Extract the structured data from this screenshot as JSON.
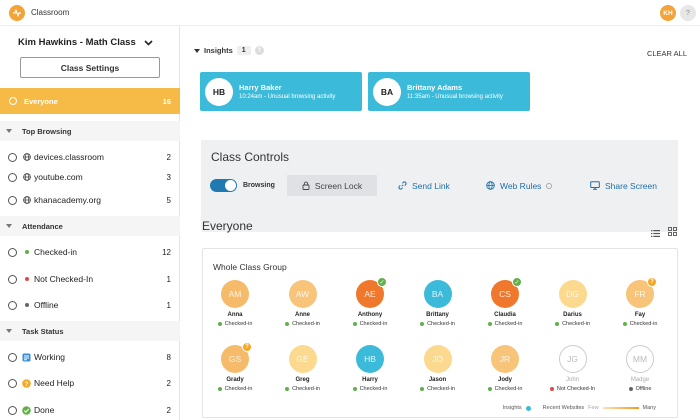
{
  "app": {
    "title": "Classroom",
    "user_initials": "KH",
    "help_label": "?"
  },
  "sidebar": {
    "class_name": "Kim Hawkins - Math Class",
    "settings_label": "Class Settings",
    "everyone": {
      "label": "Everyone",
      "count": "16"
    },
    "sections": {
      "top_browsing": "Top Browsing",
      "attendance": "Attendance",
      "task_status": "Task Status"
    },
    "top_browsing": [
      {
        "label": "devices.classroom",
        "count": "2"
      },
      {
        "label": "youtube.com",
        "count": "3"
      },
      {
        "label": "khanacademy.org",
        "count": "5"
      }
    ],
    "attendance": [
      {
        "label": "Checked-in",
        "count": "12"
      },
      {
        "label": "Not Checked-In",
        "count": "1"
      },
      {
        "label": "Offline",
        "count": "1"
      }
    ],
    "task_status": [
      {
        "label": "Working",
        "count": "8"
      },
      {
        "label": "Need Help",
        "count": "2"
      },
      {
        "label": "Done",
        "count": "2"
      }
    ]
  },
  "insights": {
    "label": "Insights",
    "count": "1",
    "help": "?",
    "clear_all": "CLEAR ALL",
    "cards": [
      {
        "initials": "HB",
        "name": "Harry Baker",
        "detail": "10:24am - Unusual browsing activity"
      },
      {
        "initials": "BA",
        "name": "Brittany Adams",
        "detail": "11:35am - Unusual browsing activity"
      }
    ]
  },
  "controls": {
    "title": "Class Controls",
    "browsing_label": "Browsing",
    "browsing_on": true,
    "screen_lock": "Screen Lock",
    "send_link": "Send Link",
    "web_rules": "Web Rules",
    "share_screen": "Share Screen"
  },
  "main": {
    "title": "Everyone",
    "group_title": "Whole Class Group"
  },
  "students": [
    {
      "initials": "AM",
      "name": "Anna",
      "status": "Checked-in",
      "color": "#f6bb6a",
      "badge": ""
    },
    {
      "initials": "AW",
      "name": "Anne",
      "status": "Checked-in",
      "color": "#f7c47a",
      "badge": ""
    },
    {
      "initials": "AE",
      "name": "Anthony",
      "status": "Checked-in",
      "color": "#f0782d",
      "badge": "check"
    },
    {
      "initials": "BA",
      "name": "Brittany",
      "status": "Checked-in",
      "color": "#3cbad9",
      "badge": ""
    },
    {
      "initials": "CS",
      "name": "Claudia",
      "status": "Checked-in",
      "color": "#f0782d",
      "badge": "check"
    },
    {
      "initials": "DG",
      "name": "Darius",
      "status": "Checked-in",
      "color": "#fbd98e",
      "badge": ""
    },
    {
      "initials": "FR",
      "name": "Fay",
      "status": "Checked-in",
      "color": "#f7c47a",
      "badge": "help"
    },
    {
      "initials": "GS",
      "name": "Grady",
      "status": "Checked-in",
      "color": "#f6bb6a",
      "badge": "help"
    },
    {
      "initials": "GE",
      "name": "Greg",
      "status": "Checked-in",
      "color": "#fbd98e",
      "badge": ""
    },
    {
      "initials": "HB",
      "name": "Harry",
      "status": "Checked-in",
      "color": "#3cbad9",
      "badge": ""
    },
    {
      "initials": "JO",
      "name": "Jason",
      "status": "Checked-in",
      "color": "#fbd98e",
      "badge": ""
    },
    {
      "initials": "JR",
      "name": "Jody",
      "status": "Checked-in",
      "color": "#f7c47a",
      "badge": ""
    },
    {
      "initials": "JG",
      "name": "John",
      "status": "Not Checked-In",
      "color": "offline",
      "badge": ""
    },
    {
      "initials": "MM",
      "name": "Madge",
      "status": "Offline",
      "color": "offline",
      "badge": ""
    }
  ],
  "legend": {
    "insights": "Insights",
    "recent": "Recent Websites",
    "few": "Few",
    "many": "Many"
  },
  "colors": {
    "accent": "#f6bb47",
    "link": "#1e6fa8",
    "insight": "#3cbad9",
    "checked": "#62b04a",
    "not_checked": "#e0484a"
  }
}
